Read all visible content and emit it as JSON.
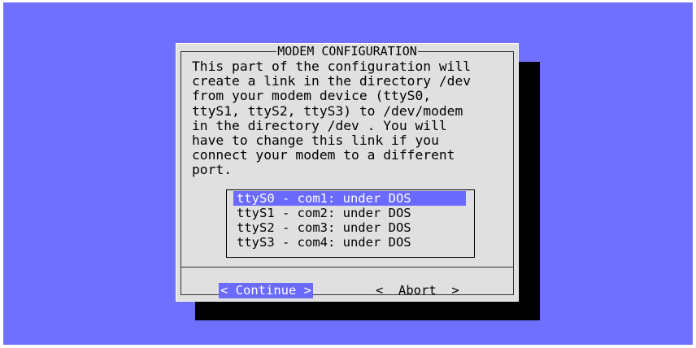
{
  "dialog": {
    "title": "MODEM CONFIGURATION",
    "message": "This part of the configuration will\ncreate a link in the directory /dev\nfrom your modem device (ttyS0,\nttyS1, ttyS2, ttyS3) to /dev/modem\nin the directory /dev . You will\nhave to change this link if you\nconnect your modem to a different\nport."
  },
  "list": {
    "items": [
      {
        "label": "ttyS0 - com1: under DOS",
        "selected": true
      },
      {
        "label": "ttyS1 - com2: under DOS",
        "selected": false
      },
      {
        "label": "ttyS2 - com3: under DOS",
        "selected": false
      },
      {
        "label": "ttyS3 - com4: under DOS",
        "selected": false
      }
    ]
  },
  "buttons": {
    "continue_label": "< Continue >",
    "abort_label": "<  Abort  >"
  },
  "colors": {
    "background": "#7070ff",
    "dialog": "#e0e0e0",
    "highlight": "#6a6aff",
    "shadow": "#000000"
  }
}
